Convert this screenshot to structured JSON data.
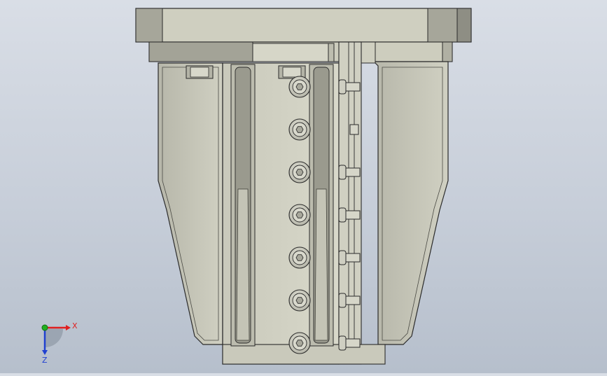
{
  "app": {
    "view": "cad-3d-viewport",
    "model": "gripper-assembly-front-view"
  },
  "colors": {
    "background_top": "#d9dee6",
    "background_bottom": "#b6bfcc",
    "part_light": "#d4d4c4",
    "part_mid": "#c5c5b5",
    "part_dark": "#a4a498",
    "edge": "#2a2a2a",
    "axis_x": "#e02020",
    "axis_y": "#20b020",
    "axis_z": "#2040d0"
  },
  "triad": {
    "x_label": "X",
    "z_label": "Z"
  },
  "icons": {
    "triad": "coordinate-triad-icon",
    "screw": "socket-head-screw-icon"
  }
}
